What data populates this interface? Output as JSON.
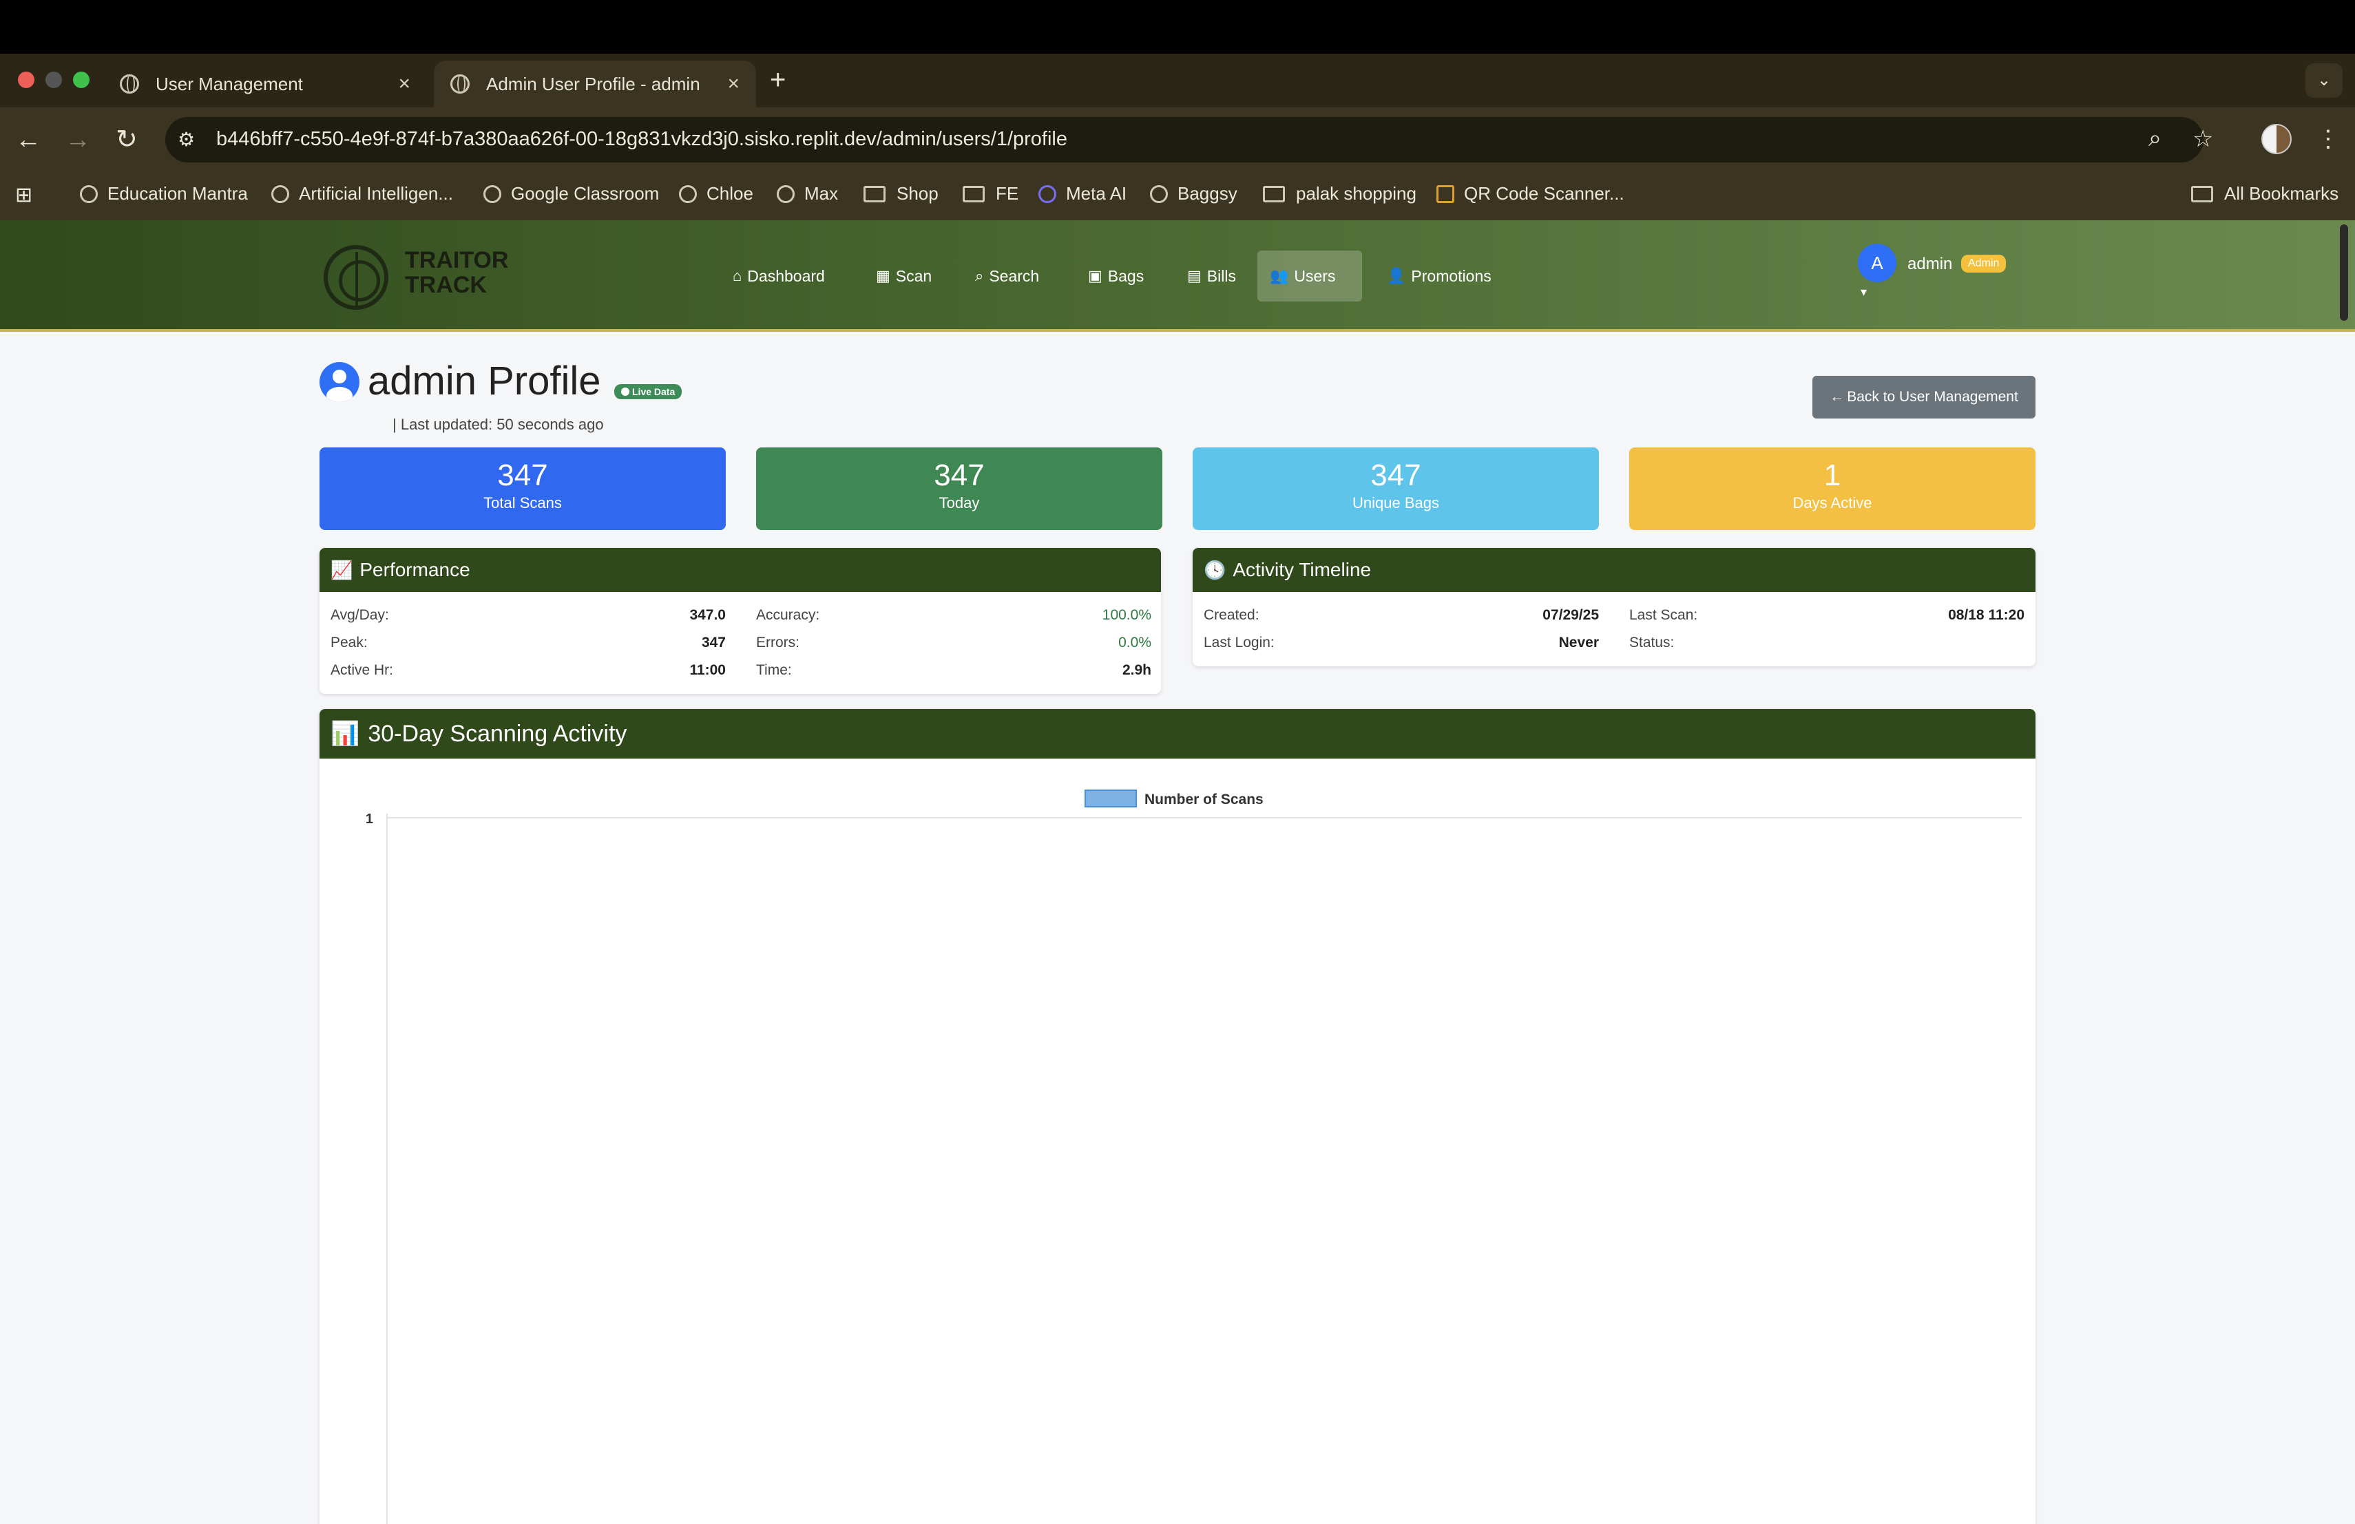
{
  "browser": {
    "tabs": [
      {
        "title": "User Management",
        "close": "×"
      },
      {
        "title": "Admin User Profile - admin",
        "close": "×"
      }
    ],
    "new_tab": "+",
    "tab_menu": "⌄",
    "url": "b446bff7-c550-4e9f-874f-b7a380aa626f-00-18g831vkzd3j0.sisko.replit.dev/admin/users/1/profile",
    "bookmarks": [
      {
        "label": "Education Mantra",
        "kind": "site"
      },
      {
        "label": "Artificial Intelligen...",
        "kind": "site"
      },
      {
        "label": "Google Classroom",
        "kind": "site"
      },
      {
        "label": "Chloe",
        "kind": "site"
      },
      {
        "label": "Max",
        "kind": "site"
      },
      {
        "label": "Shop",
        "kind": "folder"
      },
      {
        "label": "FE",
        "kind": "folder"
      },
      {
        "label": "Meta AI",
        "kind": "site"
      },
      {
        "label": "Baggsy",
        "kind": "site"
      },
      {
        "label": "palak shopping",
        "kind": "folder"
      },
      {
        "label": "QR Code Scanner...",
        "kind": "site"
      }
    ],
    "all_bookmarks": "All Bookmarks"
  },
  "app": {
    "logo_line1": "TRAITOR",
    "logo_line2": "TRACK",
    "nav": [
      {
        "label": "Dashboard",
        "icon": "home-icon"
      },
      {
        "label": "Scan",
        "icon": "qrcode-icon"
      },
      {
        "label": "Search",
        "icon": "search-icon"
      },
      {
        "label": "Bags",
        "icon": "boxes-icon"
      },
      {
        "label": "Bills",
        "icon": "file-icon"
      },
      {
        "label": "Users",
        "icon": "users-icon",
        "active": true
      },
      {
        "label": "Promotions",
        "icon": "user-cog-icon"
      }
    ],
    "user": {
      "initial": "A",
      "name": "admin",
      "role": "Admin"
    }
  },
  "profile": {
    "title": "admin Profile",
    "live_badge": "Live Data",
    "last_updated": "| Last updated: 50 seconds ago",
    "back_button": "Back to User Management"
  },
  "stats": [
    {
      "value": "347",
      "label": "Total Scans",
      "color": "#3068f0"
    },
    {
      "value": "347",
      "label": "Today",
      "color": "#3f8753"
    },
    {
      "value": "347",
      "label": "Unique Bags",
      "color": "#5ec4ea"
    },
    {
      "value": "1",
      "label": "Days Active",
      "color": "#f4c043"
    }
  ],
  "performance": {
    "title": "Performance",
    "rows": [
      {
        "label": "Avg/Day:",
        "value": "347.0"
      },
      {
        "label": "Peak:",
        "value": "347"
      },
      {
        "label": "Active Hr:",
        "value": "11:00"
      }
    ],
    "rows2": [
      {
        "label": "Accuracy:",
        "value": "100.0%"
      },
      {
        "label": "Errors:",
        "value": "0.0%"
      },
      {
        "label": "Time:",
        "value": "2.9h"
      }
    ]
  },
  "timeline": {
    "title": "Activity Timeline",
    "rows": [
      {
        "label": "Created:",
        "value": "07/29/25"
      },
      {
        "label": "Last Login:",
        "value": "Never"
      }
    ],
    "rows2": [
      {
        "label": "Last Scan:",
        "value": "08/18 11:20"
      },
      {
        "label": "Status:",
        "value": ""
      }
    ]
  },
  "chart_data": {
    "type": "bar",
    "title": "30-Day Scanning Activity",
    "series": [
      {
        "name": "Number of Scans",
        "values": []
      }
    ],
    "categories": [],
    "y_tick_labels": [
      "1"
    ],
    "legend": "top",
    "colors": {
      "series": "#7fb2e5"
    }
  }
}
